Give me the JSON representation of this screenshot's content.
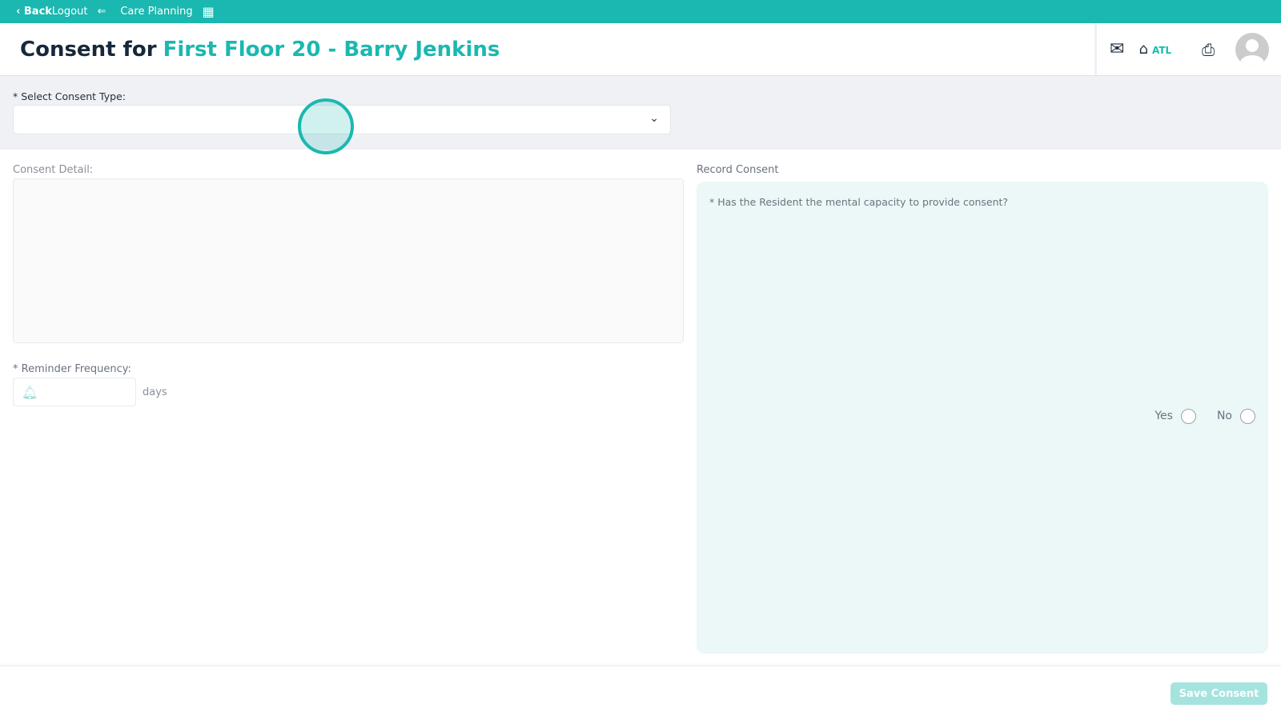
{
  "topbar": {
    "back": "‹ Back",
    "logout": "Logout",
    "app": "Care Planning"
  },
  "header": {
    "title_prefix": "Consent for",
    "title_highlight": "First Floor 20 - Barry Jenkins",
    "home_label": "ATL"
  },
  "form": {
    "consent_type_label": "* Select Consent Type:",
    "consent_type_value": "",
    "consent_detail_label": "Consent Detail:",
    "reminder_label": "* Reminder Frequency:",
    "reminder_unit": "days",
    "reminder_value": ""
  },
  "record": {
    "title": "Record Consent",
    "question": "* Has the Resident the mental capacity to provide consent?",
    "yes": "Yes",
    "no": "No"
  },
  "footer": {
    "save": "Save Consent"
  },
  "colors": {
    "accent": "#1ab8b0"
  }
}
